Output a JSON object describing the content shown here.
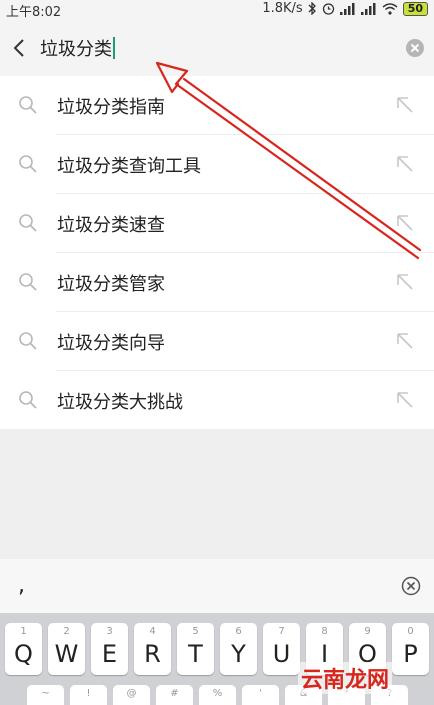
{
  "status": {
    "time": "上午8:02",
    "speed": "1.8K/s",
    "battery": "50",
    "icons": [
      "bluetooth-icon",
      "alarm-icon",
      "signal-icon",
      "signal-icon",
      "wifi-icon"
    ]
  },
  "search": {
    "query": "垃圾分类"
  },
  "suggestions": [
    {
      "label": "垃圾分类指南"
    },
    {
      "label": "垃圾分类查询工具"
    },
    {
      "label": "垃圾分类速查"
    },
    {
      "label": "垃圾分类管家"
    },
    {
      "label": "垃圾分类向导"
    },
    {
      "label": "垃圾分类大挑战"
    }
  ],
  "candidates": {
    "first": ","
  },
  "keyboard": {
    "row1": [
      {
        "hint": "1",
        "key": "Q"
      },
      {
        "hint": "2",
        "key": "W"
      },
      {
        "hint": "3",
        "key": "E"
      },
      {
        "hint": "4",
        "key": "R"
      },
      {
        "hint": "5",
        "key": "T"
      },
      {
        "hint": "6",
        "key": "Y"
      },
      {
        "hint": "7",
        "key": "U"
      },
      {
        "hint": "8",
        "key": "I"
      },
      {
        "hint": "9",
        "key": "O"
      },
      {
        "hint": "0",
        "key": "P"
      }
    ],
    "row2_hints": [
      "~",
      "!",
      "@",
      "#",
      "%",
      "'",
      "&",
      "*",
      "?"
    ]
  },
  "annotation": {
    "arrow_color": "#d8261c"
  },
  "watermark": {
    "text": "云南龙网"
  }
}
